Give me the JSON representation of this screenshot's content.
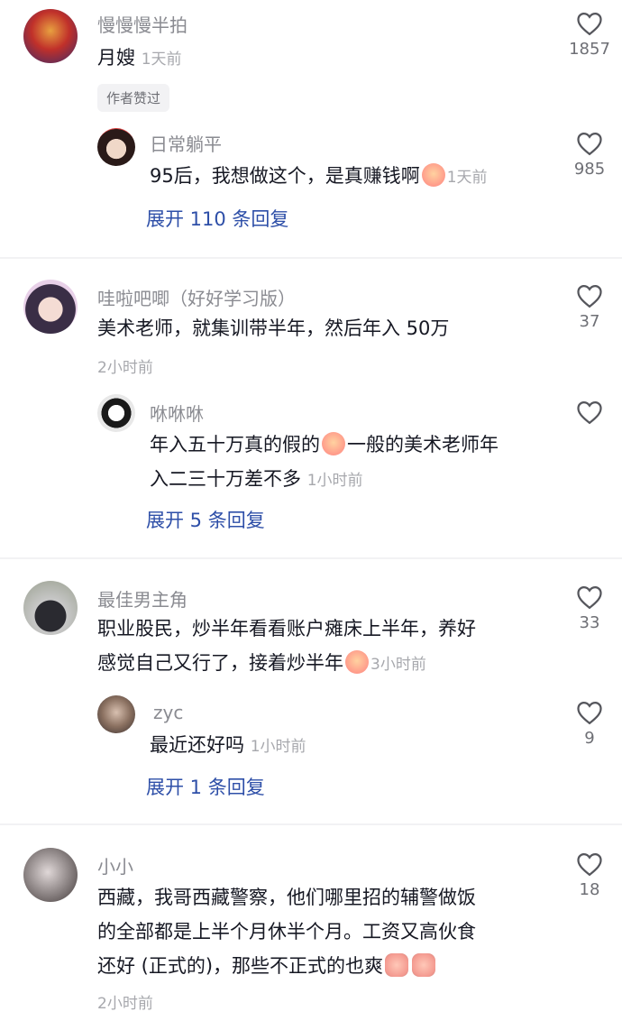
{
  "comments": [
    {
      "username": "慢慢慢半拍",
      "text": "月嫂",
      "time": "1天前",
      "likes": "1857",
      "badge": "作者赞过",
      "reply": {
        "username": "日常躺平",
        "text": "95后，我想做这个，是真赚钱啊",
        "time": "1天前",
        "likes": "985"
      },
      "expand": "展开 110 条回复"
    },
    {
      "username": "哇啦吧唧（好好学习版）",
      "text": "美术老师，就集训带半年，然后年入 50万",
      "time": "2小时前",
      "likes": "37",
      "reply": {
        "username": "咻咻咻",
        "text_1": "年入五十万真的假的",
        "text_2": "一般的美术老师年",
        "text_3": "入二三十万差不多",
        "time": "1小时前"
      },
      "expand": "展开 5 条回复"
    },
    {
      "username": "最佳男主角",
      "text_1": "职业股民，炒半年看看账户瘫床上半年，养好",
      "text_2": "感觉自己又行了，接着炒半年",
      "time": "3小时前",
      "likes": "33",
      "reply": {
        "username": "zyc",
        "text": "最近还好吗",
        "time": "1小时前",
        "likes": "9"
      },
      "expand": "展开 1 条回复"
    },
    {
      "username": "小小",
      "text_1": "西藏，我哥西藏警察，他们哪里招的辅警做饭",
      "text_2": "的全部都是上半个月休半个月。工资又高伙食",
      "text_3": "还好 (正式的)，那些不正式的也爽",
      "time": "2小时前",
      "likes": "18"
    }
  ]
}
